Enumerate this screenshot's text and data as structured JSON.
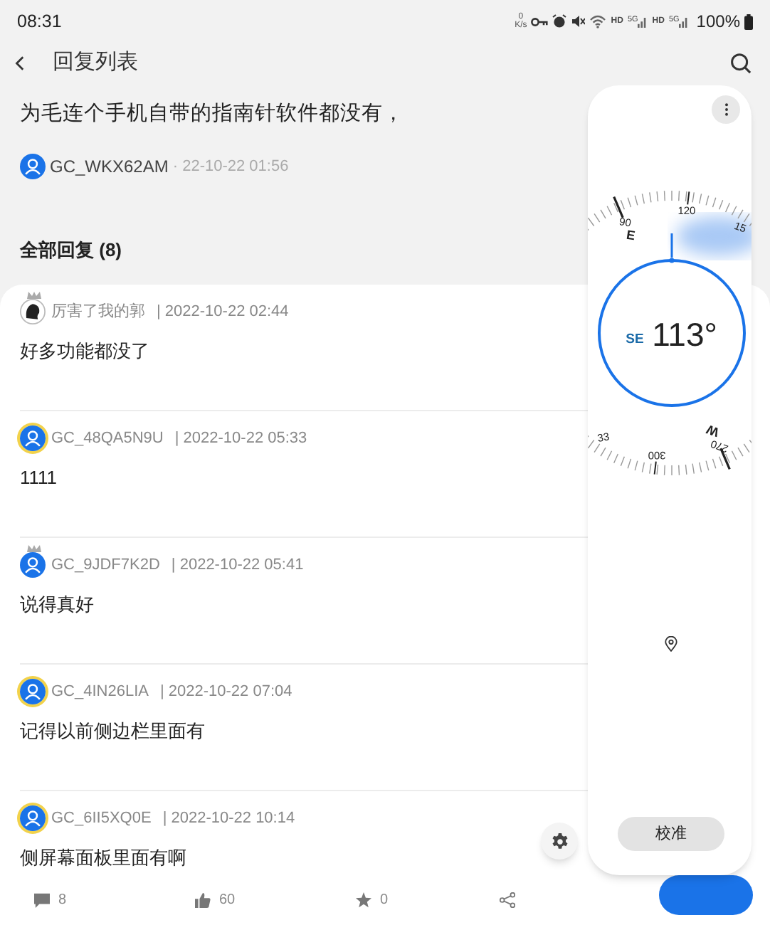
{
  "status_bar": {
    "time": "08:31",
    "net_speed_value": "0",
    "net_speed_unit": "K/s",
    "hd_1": "HD",
    "hd_2": "HD",
    "signal_1": "5G",
    "signal_2": "5G",
    "battery": "100%"
  },
  "header": {
    "title": "回复列表"
  },
  "post": {
    "title": "为毛连个手机自带的指南针软件都没有，",
    "author": "GC_WKX62AM",
    "time": "· 22-10-22 01:56"
  },
  "section": {
    "title": "全部回复 (8)"
  },
  "comments": [
    {
      "kind": "custom",
      "crown": true,
      "ring": false,
      "author": "厉害了我的郭",
      "time": "| 2022-10-22 02:44",
      "text": "好多功能都没了"
    },
    {
      "kind": "default",
      "crown": false,
      "ring": true,
      "author": "GC_48QA5N9U",
      "time": "| 2022-10-22 05:33",
      "text": "1111"
    },
    {
      "kind": "default",
      "crown": true,
      "ring": false,
      "author": "GC_9JDF7K2D",
      "time": "| 2022-10-22 05:41",
      "text": "说得真好"
    },
    {
      "kind": "default",
      "crown": false,
      "ring": true,
      "author": "GC_4IN26LIA",
      "time": "| 2022-10-22 07:04",
      "text": "记得以前侧边栏里面有"
    },
    {
      "kind": "default",
      "crown": false,
      "ring": true,
      "author": "GC_6II5XQ0E",
      "time": "| 2022-10-22 10:14",
      "text": "侧屏幕面板里面有啊"
    }
  ],
  "compass": {
    "dial_labels": [
      "90",
      "E",
      "120",
      "15",
      "33",
      "300",
      "W",
      "270"
    ],
    "direction": "SE",
    "heading": "113°",
    "calibrate_button": "校准"
  },
  "bottom_bar": {
    "comments": "8",
    "likes": "60",
    "favorites": "0"
  }
}
